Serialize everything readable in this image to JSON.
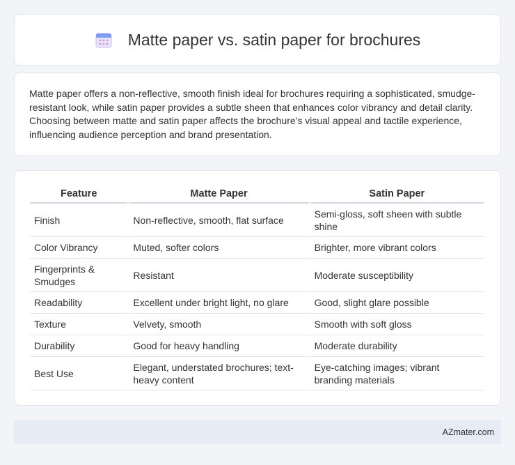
{
  "header": {
    "title": "Matte paper vs. satin paper for brochures",
    "icon": "calendar-icon"
  },
  "intro": {
    "text": "Matte paper offers a non-reflective, smooth finish ideal for brochures requiring a sophisticated, smudge-resistant look, while satin paper provides a subtle sheen that enhances color vibrancy and detail clarity. Choosing between matte and satin paper affects the brochure's visual appeal and tactile experience, influencing audience perception and brand presentation."
  },
  "table": {
    "headers": [
      "Feature",
      "Matte Paper",
      "Satin Paper"
    ],
    "rows": [
      [
        "Finish",
        "Non-reflective, smooth, flat surface",
        "Semi-gloss, soft sheen with subtle shine"
      ],
      [
        "Color Vibrancy",
        "Muted, softer colors",
        "Brighter, more vibrant colors"
      ],
      [
        "Fingerprints & Smudges",
        "Resistant",
        "Moderate susceptibility"
      ],
      [
        "Readability",
        "Excellent under bright light, no glare",
        "Good, slight glare possible"
      ],
      [
        "Texture",
        "Velvety, smooth",
        "Smooth with soft gloss"
      ],
      [
        "Durability",
        "Good for heavy handling",
        "Moderate durability"
      ],
      [
        "Best Use",
        "Elegant, understated brochures; text-heavy content",
        "Eye-catching images; vibrant branding materials"
      ]
    ]
  },
  "footer": {
    "brand": "AZmater.com"
  }
}
